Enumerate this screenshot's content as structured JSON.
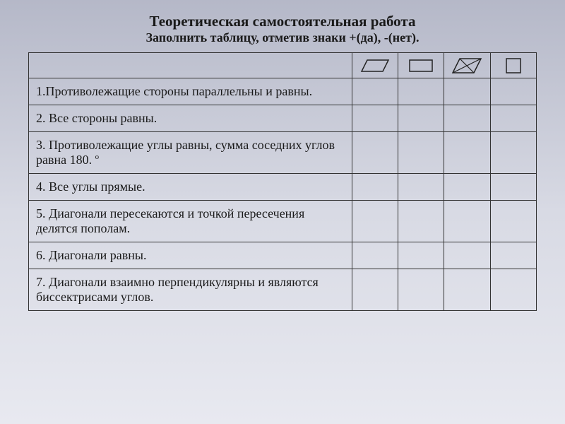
{
  "title": "Теоретическая самостоятельная работа",
  "subtitle": "Заполнить таблицу, отметив знаки +(да), -(нет).",
  "shapes": {
    "parallelogram": "parallelogram-icon",
    "rectangle": "rectangle-icon",
    "rhombus": "rhombus-icon",
    "square": "square-icon"
  },
  "rows": [
    {
      "text": "1.Противолежащие стороны параллельны и равны."
    },
    {
      "text": "2. Все стороны равны."
    },
    {
      "text_pre": "3. Противолежащие углы равны, сумма соседних углов равна 180. ",
      "has_sup": true,
      "sup": "о"
    },
    {
      "text": "4. Все углы прямые."
    },
    {
      "text": "5. Диагонали пересекаются и точкой пересечения делятся пополам."
    },
    {
      "text": "6. Диагонали равны."
    },
    {
      "text": "7. Диагонали взаимно перпендикулярны и являются биссектрисами углов."
    }
  ]
}
